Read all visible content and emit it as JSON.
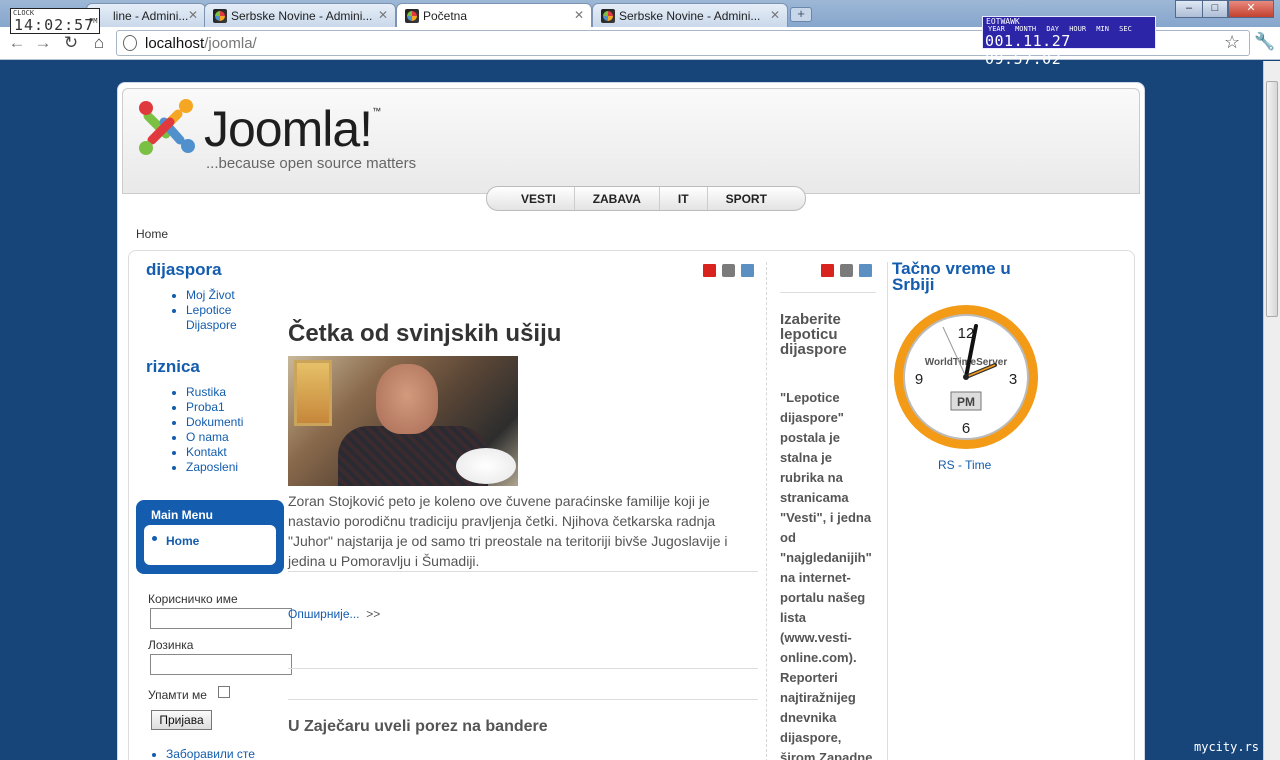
{
  "browser": {
    "tabs": [
      {
        "title": "Serbske Novine - Admini...",
        "visible_text": "line - Admini..."
      },
      {
        "title": "Serbske Novine - Admini..."
      },
      {
        "title": "Početna"
      },
      {
        "title": "Serbske Novine - Admini..."
      }
    ],
    "url_host": "localhost",
    "url_path": "/joomla/",
    "window_buttons": [
      "–",
      "□",
      "✕"
    ]
  },
  "widgets": {
    "clock_label": "CLOCK",
    "clock_time": "14:02:57",
    "clock_ampm": "PM",
    "eot_title": "EOTWAWK",
    "eot_headers": "YEAR MONTH DAY HOUR MIN SEC",
    "eot_values": "001.11.27 09:57:02",
    "corner_brand": "mycity.rs"
  },
  "site": {
    "logo_text": "Joomla!",
    "logo_tm": "™",
    "tagline": "...because open source matters",
    "topnav": [
      "VESTI",
      "ZABAVA",
      "IT",
      "SPORT"
    ],
    "breadcrumb": "Home"
  },
  "left": {
    "dijaspora_title": "dijaspora",
    "dijaspora_links": [
      "Moj Život",
      "Lepotice Dijaspore"
    ],
    "riznica_title": "riznica",
    "riznica_links": [
      "Rustika",
      "Proba1",
      "Dokumenti",
      "O nama",
      "Kontakt",
      "Zaposleni"
    ],
    "mainmenu_title": "Main Menu",
    "mainmenu_item": "Home",
    "login": {
      "username_label": "Корисничко име",
      "password_label": "Лозинка",
      "remember_label": "Упамти ме",
      "submit": "Пријава",
      "forgot": "Заборавили сте"
    }
  },
  "article": {
    "title": "Četka od svinjskih ušiju",
    "body": "Zoran Stojković peto je koleno ove čuvene paraćinske familije koji je nastavio porodičnu tradiciju pravljenja četki. Njihova četkarska radnja \"Juhor\" najstarija je od samo tri preostale na teritoriji bivše Jugoslavije i jedina u Pomoravlju i Šumadiji.",
    "more": "Опширније...",
    "more_arrow": ">>",
    "next_title": "U Zaječaru uveli porez na bandere"
  },
  "middle": {
    "title": "Izaberite lepoticu dijaspore",
    "text": "\"Lepotice dijaspore\" postala je stalna je rubrika na stranicama \"Vesti\", i jedna od \"najgledanijih\" na internet-portalu našeg lista (www.vesti-online.com). Reporteri najtiražnijeg dnevnika dijaspore, širom Zapadne"
  },
  "right": {
    "title": "Tačno vreme u Srbiji",
    "clock_brand": "WorldTimeServer",
    "clock_ampm": "PM",
    "numerals": [
      "12",
      "3",
      "6",
      "9"
    ],
    "link": "RS - Time"
  },
  "colors": {
    "accent": "#135cae",
    "background": "#17457a"
  }
}
